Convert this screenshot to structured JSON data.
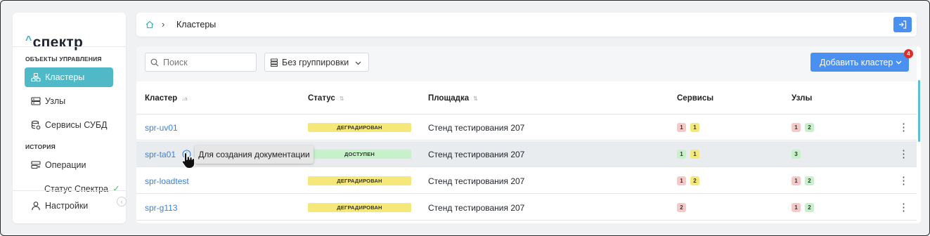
{
  "app": {
    "logo": "спектр"
  },
  "sidebar": {
    "section_objects": "ОБЪЕКТЫ УПРАВЛЕНИЯ",
    "section_history": "ИСТОРИЯ",
    "items": [
      {
        "label": "Кластеры",
        "icon": "clusters-icon",
        "active": true
      },
      {
        "label": "Узлы",
        "icon": "nodes-icon",
        "active": false
      },
      {
        "label": "Сервисы СУБД",
        "icon": "dbms-services-icon",
        "active": false
      },
      {
        "label": "Операции",
        "icon": "operations-icon",
        "active": false
      },
      {
        "label": "Настройки",
        "icon": "user-icon",
        "active": false
      }
    ],
    "status_label": "Статус Спектра",
    "status_ok_color": "#5cc46b"
  },
  "breadcrumb": {
    "title": "Кластеры"
  },
  "toolbar": {
    "search_placeholder": "Поиск",
    "grouping_value": "Без группировки",
    "add_label": "Добавить кластер",
    "notifications_count": "4"
  },
  "table": {
    "columns": [
      "Кластер",
      "Статус",
      "Площадка",
      "Сервисы",
      "Узлы"
    ],
    "rows": [
      {
        "name": "spr-uv01",
        "status": "ДЕГРАДИРОВАН",
        "status_kind": "degraded",
        "site": "Стенд тестирования 207",
        "services": [
          {
            "v": "1",
            "c": "red"
          },
          {
            "v": "1",
            "c": "yellow"
          }
        ],
        "nodes": [
          {
            "v": "1",
            "c": "red"
          },
          {
            "v": "2",
            "c": "green"
          }
        ]
      },
      {
        "name": "spr-ta01",
        "status": "ДОСТУПЕН",
        "status_kind": "available",
        "site": "Стенд тестирования 207",
        "services": [
          {
            "v": "1",
            "c": "green"
          },
          {
            "v": "1",
            "c": "yellow"
          }
        ],
        "nodes": [
          {
            "v": "3",
            "c": "green"
          }
        ]
      },
      {
        "name": "spr-loadtest",
        "status": "ДЕГРАДИРОВАН",
        "status_kind": "degraded",
        "site": "Стенд тестирования 207",
        "services": [
          {
            "v": "1",
            "c": "red"
          },
          {
            "v": "2",
            "c": "yellow"
          }
        ],
        "nodes": [
          {
            "v": "1",
            "c": "red"
          },
          {
            "v": "2",
            "c": "green"
          }
        ]
      },
      {
        "name": "spr-g113",
        "status": "ДЕГРАДИРОВАН",
        "status_kind": "degraded",
        "site": "Стенд тестирования 207",
        "services": [
          {
            "v": "2",
            "c": "red"
          }
        ],
        "nodes": [
          {
            "v": "1",
            "c": "red"
          },
          {
            "v": "2",
            "c": "green"
          }
        ]
      }
    ]
  },
  "tooltip": {
    "text": "Для создания документации"
  },
  "colors": {
    "accent": "#4fb9c7",
    "primary_button": "#4a90f0",
    "link": "#3d7fd6"
  }
}
